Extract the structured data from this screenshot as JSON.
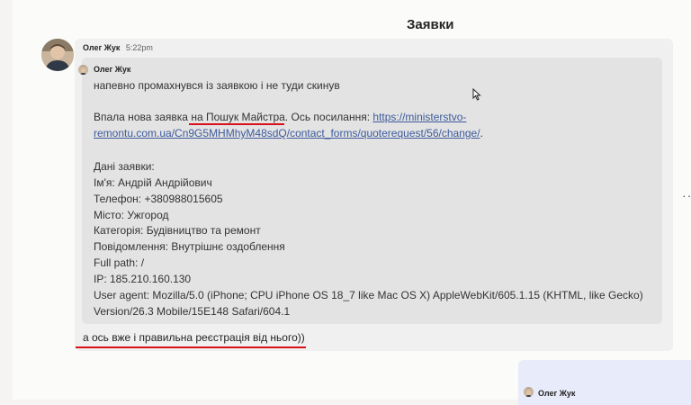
{
  "channel": {
    "title": "Заявки"
  },
  "message": {
    "author": "Олег Жук",
    "time": "5:22pm",
    "quote": {
      "author": "Олег Жук",
      "line1": "напевно промахнувся із заявкою і не туди скинув",
      "line2_prefix": "Впала нова заявка ",
      "line2_site": "на Пошук Майстра.",
      "line2_mid": " Ось посилання: ",
      "line2_link_part1": "https://ministerstvo-",
      "line3_link_part2": "remontu.com.ua/Cn9G5MHMhyM48sdQ/contact_forms/quoterequest/56/change/",
      "line3_suffix": ".",
      "details_title": "Дані заявки:",
      "name": "Ім'я: Андрій Андрійович",
      "phone": "Телефон: +380988015605",
      "city": "Місто: Ужгород",
      "category": "Категорія: Будівництво та ремонт",
      "message": "Повідомлення: Внутрішнє оздоблення",
      "full_path": "Full path: /",
      "ip": "IP: 185.210.160.130",
      "user_agent_1": "User agent: Mozilla/5.0 (iPhone; CPU iPhone OS 18_7 like Mac OS X) AppleWebKit/605.1.15 (KHTML, like Gecko)",
      "user_agent_2": "Version/26.3 Mobile/15E148 Safari/604.1"
    },
    "reply": "а ось вже і правильна реєстрація від нього))"
  },
  "next_message": {
    "author": "Олег Жук"
  },
  "icons": {
    "more": "more-horizontal-icon",
    "cursor": "mouse-pointer-icon"
  },
  "colors": {
    "link": "#3d5b9c",
    "annotation_red": "#d9111a",
    "own_message_bg": "#e8ebfa"
  }
}
